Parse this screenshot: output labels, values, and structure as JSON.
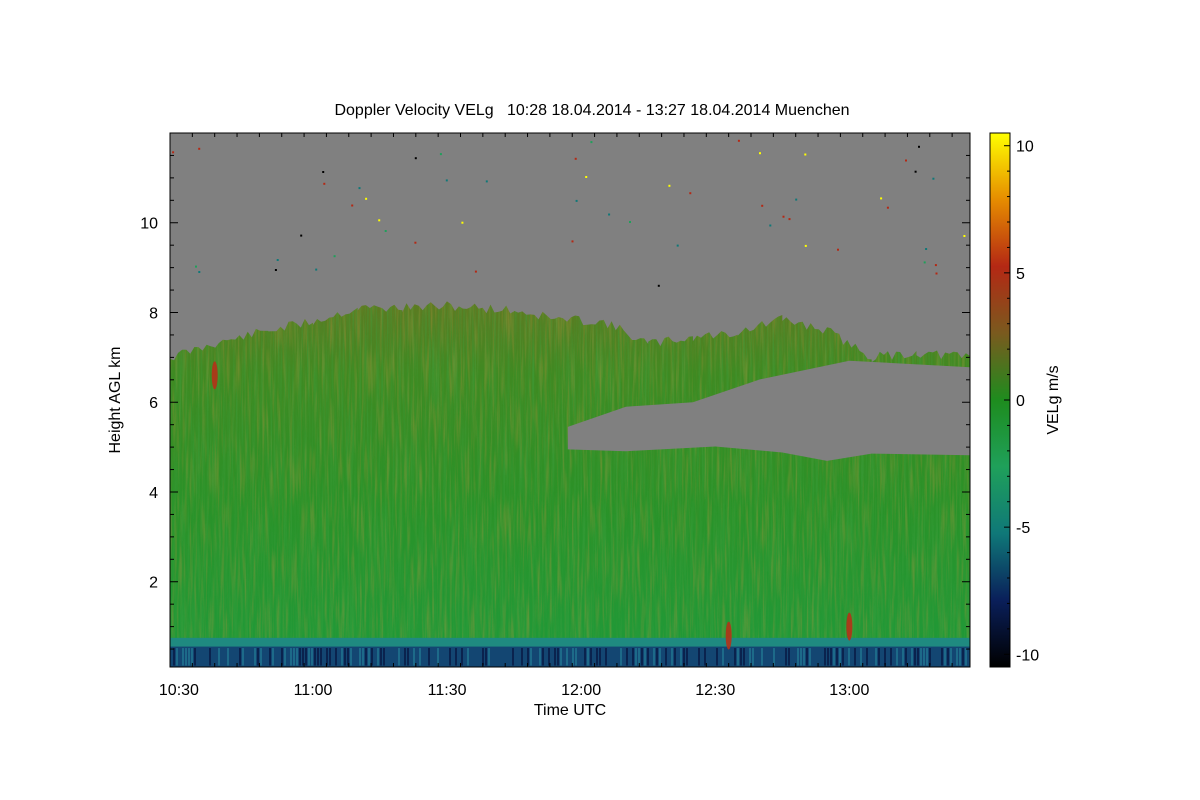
{
  "chart_data": {
    "type": "heatmap",
    "title": "Doppler Velocity VELg   10:28 18.04.2014 - 13:27 18.04.2014 Muenchen",
    "xlabel": "Time UTC",
    "ylabel": "Height AGL km",
    "colorbar_label": "VELg m/s",
    "xlim": [
      "10:28",
      "13:27"
    ],
    "ylim": [
      0.1,
      12.0
    ],
    "x_ticks": [
      "10:30",
      "11:00",
      "11:30",
      "12:00",
      "12:30",
      "13:00"
    ],
    "y_ticks": [
      "2",
      "4",
      "6",
      "8",
      "10"
    ],
    "colorbar_range": [
      -10.5,
      10.5
    ],
    "colorbar_ticks": [
      "10",
      "5",
      "0",
      "-5",
      "-10"
    ],
    "colormap": [
      "#000000",
      "#0a1f5a",
      "#0f7878",
      "#1fa05a",
      "#1e8c1e",
      "#7a5a1e",
      "#b42814",
      "#e68c00",
      "#ffff00"
    ],
    "no_signal_color": "#808080",
    "cloud_top_km": [
      [
        "10:28",
        7.0
      ],
      [
        "10:38",
        7.3
      ],
      [
        "10:50",
        7.6
      ],
      [
        "11:00",
        7.8
      ],
      [
        "11:10",
        8.1
      ],
      [
        "11:20",
        8.1
      ],
      [
        "11:30",
        8.15
      ],
      [
        "11:45",
        8.05
      ],
      [
        "11:55",
        7.85
      ],
      [
        "12:05",
        7.8
      ],
      [
        "12:15",
        7.3
      ],
      [
        "12:25",
        7.45
      ],
      [
        "12:35",
        7.55
      ],
      [
        "12:45",
        7.85
      ],
      [
        "12:55",
        7.6
      ],
      [
        "13:05",
        7.0
      ],
      [
        "13:15",
        7.1
      ],
      [
        "13:27",
        7.0
      ]
    ],
    "cloud_gap_km": [
      [
        "11:57",
        5.45
      ],
      [
        "12:10",
        5.9
      ],
      [
        "12:25",
        6.0
      ],
      [
        "12:40",
        6.5
      ],
      [
        "13:00",
        6.9
      ],
      [
        "13:27",
        6.8
      ],
      [
        "13:27",
        4.85
      ],
      [
        "13:05",
        4.85
      ],
      [
        "12:55",
        4.75
      ],
      [
        "12:45",
        4.9
      ],
      [
        "12:30",
        5.0
      ],
      [
        "12:10",
        4.95
      ],
      [
        "11:57",
        4.95
      ]
    ],
    "near_surface_layer_km": [
      0.1,
      0.75
    ],
    "updrafts": [
      {
        "time": "10:38",
        "height_km": 6.6,
        "velocity_ms": 1.5
      },
      {
        "time": "13:00",
        "height_km": 1.0,
        "velocity_ms": 1.0
      },
      {
        "time": "12:33",
        "height_km": 0.8,
        "velocity_ms": 1.0
      }
    ]
  }
}
